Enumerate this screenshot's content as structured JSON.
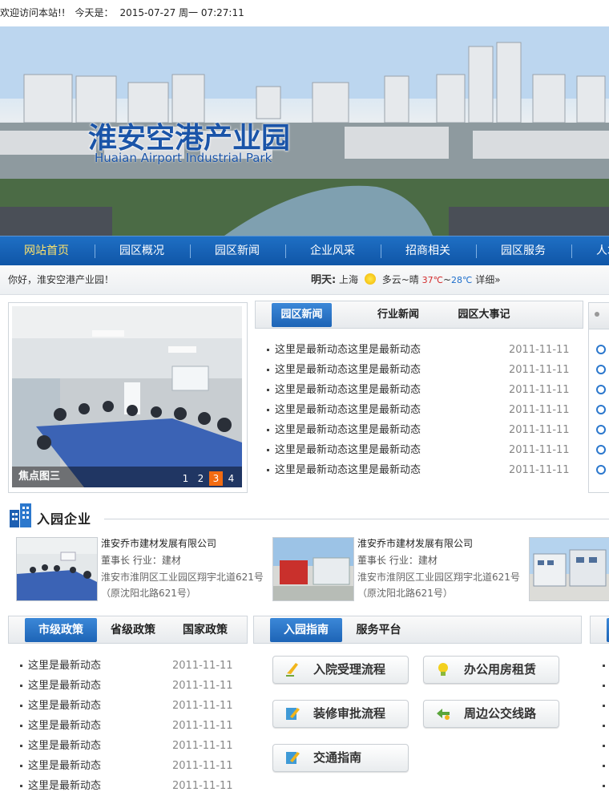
{
  "topbar": {
    "welcome": "欢迎访问本站!!",
    "date_label": "今天是：",
    "date_value": "2015-07-27 周一 07:27:11"
  },
  "banner": {
    "title_cn": "淮安空港产业园",
    "title_en": "Huaian Airport Industrial Park"
  },
  "nav": {
    "items": [
      "网站首页",
      "园区概况",
      "园区新闻",
      "企业风采",
      "招商相关",
      "园区服务",
      "人才"
    ]
  },
  "infobar": {
    "greeting": "你好，淮安空港产业园！",
    "weather_label": "明天:",
    "city": "上海",
    "condition": "多云~晴",
    "high": "37℃",
    "sep": "~",
    "low": "28℃",
    "detail": "详细»"
  },
  "focus": {
    "caption": "焦点图三",
    "pages": [
      "1",
      "2",
      "3",
      "4"
    ],
    "active_page": "3"
  },
  "news": {
    "tabs": [
      "园区新闻",
      "行业新闻",
      "园区大事记"
    ],
    "items": [
      {
        "title": "这里是最新动态这里是最新动态",
        "date": "2011-11-11"
      },
      {
        "title": "这里是最新动态这里是最新动态",
        "date": "2011-11-11"
      },
      {
        "title": "这里是最新动态这里是最新动态",
        "date": "2011-11-11"
      },
      {
        "title": "这里是最新动态这里是最新动态",
        "date": "2011-11-11"
      },
      {
        "title": "这里是最新动态这里是最新动态",
        "date": "2011-11-11"
      },
      {
        "title": "这里是最新动态这里是最新动态",
        "date": "2011-11-11"
      },
      {
        "title": "这里是最新动态这里是最新动态",
        "date": "2011-11-11"
      }
    ]
  },
  "companies": {
    "section_title": "入园企业",
    "items": [
      {
        "name": "淮安乔市建材发展有限公司",
        "meta": "董事长 行业：建材",
        "addr": "淮安市淮阴区工业园区翔宇北道621号",
        "addr2": "（原沈阳北路621号）"
      },
      {
        "name": "淮安乔市建材发展有限公司",
        "meta": "董事长 行业：建材",
        "addr": "淮安市淮阴区工业园区翔宇北道621号",
        "addr2": "（原沈阳北路621号）"
      }
    ]
  },
  "policy": {
    "tabs": [
      "市级政策",
      "省级政策",
      "国家政策"
    ],
    "items": [
      {
        "title": "这里是最新动态",
        "date": "2011-11-11"
      },
      {
        "title": "这里是最新动态",
        "date": "2011-11-11"
      },
      {
        "title": "这里是最新动态",
        "date": "2011-11-11"
      },
      {
        "title": "这里是最新动态",
        "date": "2011-11-11"
      },
      {
        "title": "这里是最新动态",
        "date": "2011-11-11"
      },
      {
        "title": "这里是最新动态",
        "date": "2011-11-11"
      },
      {
        "title": "这里是最新动态",
        "date": "2011-11-11"
      }
    ]
  },
  "guide": {
    "tabs": [
      "入园指南",
      "服务平台"
    ],
    "buttons": [
      "入院受理流程",
      "办公用房租赁",
      "装修审批流程",
      "周边公交线路",
      "交通指南"
    ]
  }
}
